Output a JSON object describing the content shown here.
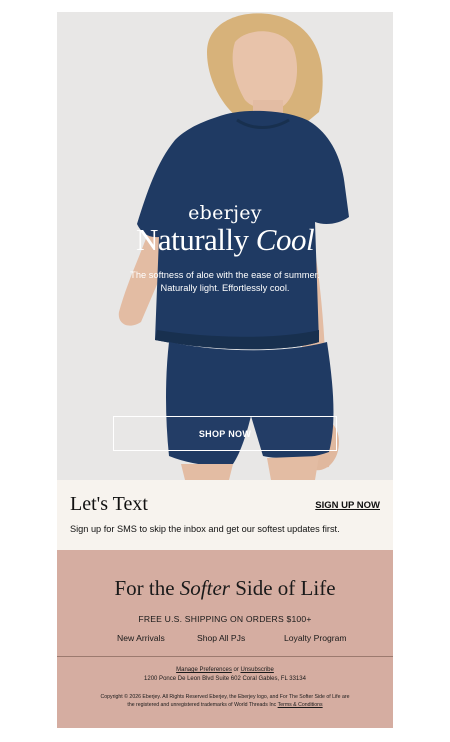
{
  "hero": {
    "brand": "eberjey",
    "headline_main": "Naturally ",
    "headline_italic": "Cool",
    "subtext_line1": "The softness of aloe with the ease of summer.",
    "subtext_line2": "Naturally light. Effortlessly cool.",
    "cta_label": "SHOP NOW",
    "colors": {
      "background": "#e8e7e6",
      "garment": "#1f3a63",
      "skin": "#e3bca3",
      "hair": "#d7b27a"
    }
  },
  "sms": {
    "title": "Let's Text",
    "cta_label": "SIGN UP NOW",
    "description": "Sign up for SMS to skip the inbox and get our softest updates first.",
    "background": "#f7f3ee"
  },
  "footer": {
    "tagline_start": "For the ",
    "tagline_italic": "Softer",
    "tagline_end": " Side of Life",
    "shipping": "FREE U.S. SHIPPING ON ORDERS $100+",
    "nav": [
      "New Arrivals",
      "Shop All PJs",
      "Loyalty Program"
    ],
    "manage_preferences": "Manage Preferences",
    "or": " or ",
    "unsubscribe": "Unsubscribe",
    "address": "1200 Ponce De Leon Blvd Suite 602 Coral Gables, FL 33134",
    "copyright": "Copyright © 2026 Eberjey. All Rights Reserved Eberjey, the Eberjey logo, and For The Softer Side of Life are the registered and unregistered trademarks of World Threads Inc",
    "terms": "Terms & Conditions",
    "background": "#d5ada1"
  }
}
